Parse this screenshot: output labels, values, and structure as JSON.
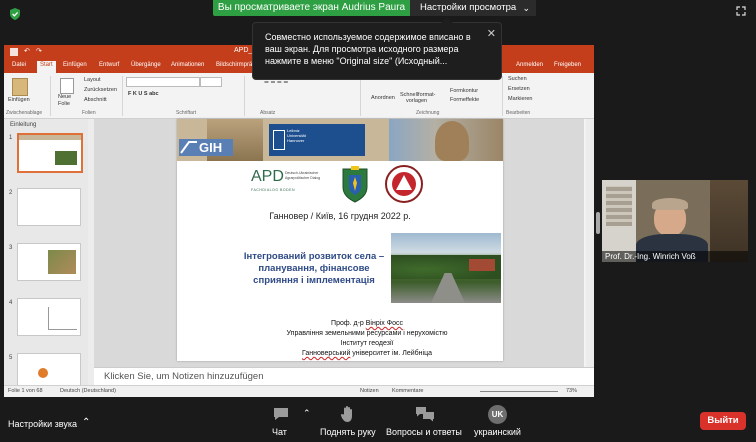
{
  "top_bar": {
    "share_banner": "Вы просматриваете экран Audrius Paura",
    "view_options": "Настройки просмотра"
  },
  "tooltip": {
    "text": "Совместно используемое содержимое вписано в ваш экран. Для просмотра исходного размера нажмите в меню \"Original size\" (Исходный..."
  },
  "ppt": {
    "title": "APD_D...",
    "tabs": [
      "Datei",
      "Start",
      "Einfügen",
      "Entwurf",
      "Übergänge",
      "Animationen",
      "Bildschirmpräs...",
      "Anmelden",
      "Freigeben"
    ],
    "ribbon": {
      "paste": "Einfügen",
      "new_slide_1": "Neue",
      "new_slide_2": "Folie",
      "layout": "Layout",
      "reset": "Zurücksetzen",
      "section": "Abschnitt",
      "groups": [
        "Zwischenablage",
        "Folien",
        "Schriftart",
        "Absatz",
        "Zeichnung",
        "Bearbeiten"
      ],
      "arrange": "Anordnen",
      "quick_styles_1": "Schnellformat-",
      "quick_styles_2": "vorlagen",
      "shape_fill": "Formkontur",
      "shape_effects": "Formeffekte",
      "find": "Suchen",
      "replace": "Ersetzen",
      "select": "Markieren"
    },
    "thumbs_section": "Einleitung",
    "thumb_numbers": [
      "1",
      "2",
      "3",
      "4",
      "5"
    ],
    "notes_placeholder": "Klicken Sie, um Notizen hinzuzufügen",
    "status_left": "Folie 1 von 68",
    "status_lang": "Deutsch (Deutschland)",
    "status_notes": "Notizen",
    "status_comments": "Kommentare",
    "zoom": "73%"
  },
  "slide": {
    "date_line": "Ганновер / Київ, 16 грудня 2022 р.",
    "title": "Інтегрований розвиток села – планування, фінансове сприяння і імплементація",
    "author_prefix": "Проф. д-р ",
    "author_name": "Вінріх Фосс",
    "dept": "Управління земельними ресурсами і нерухомістю",
    "institute": "Інститут геодезії",
    "university_name": "Ганноверський",
    "university_rest": " університет ім. Лейбніца",
    "gih_logo": "GIH",
    "luh_logo_1": "Leibniz",
    "luh_logo_2": "Universität",
    "luh_logo_3": "Hannover",
    "apd_logo": "APD",
    "apd_sub_1": "Deutsch-Ukrainischer",
    "apd_sub_2": "Agrarpolitischer Dialog",
    "apd_sub_3": "FACHDIALOG BODEN"
  },
  "participant": {
    "name": "Prof. Dr.-Ing. Winrich Voß"
  },
  "bottom_bar": {
    "audio_settings": "Настройки звука",
    "chat": "Чат",
    "raise_hand": "Поднять руку",
    "qa": "Вопросы и ответы",
    "language_badge": "UK",
    "language": "украинский",
    "leave": "Выйти"
  },
  "colors": {
    "ppt_accent": "#c43e1c",
    "share_green": "#2ea043",
    "leave_red": "#d9322b",
    "slide_title_blue": "#2e4a86"
  }
}
